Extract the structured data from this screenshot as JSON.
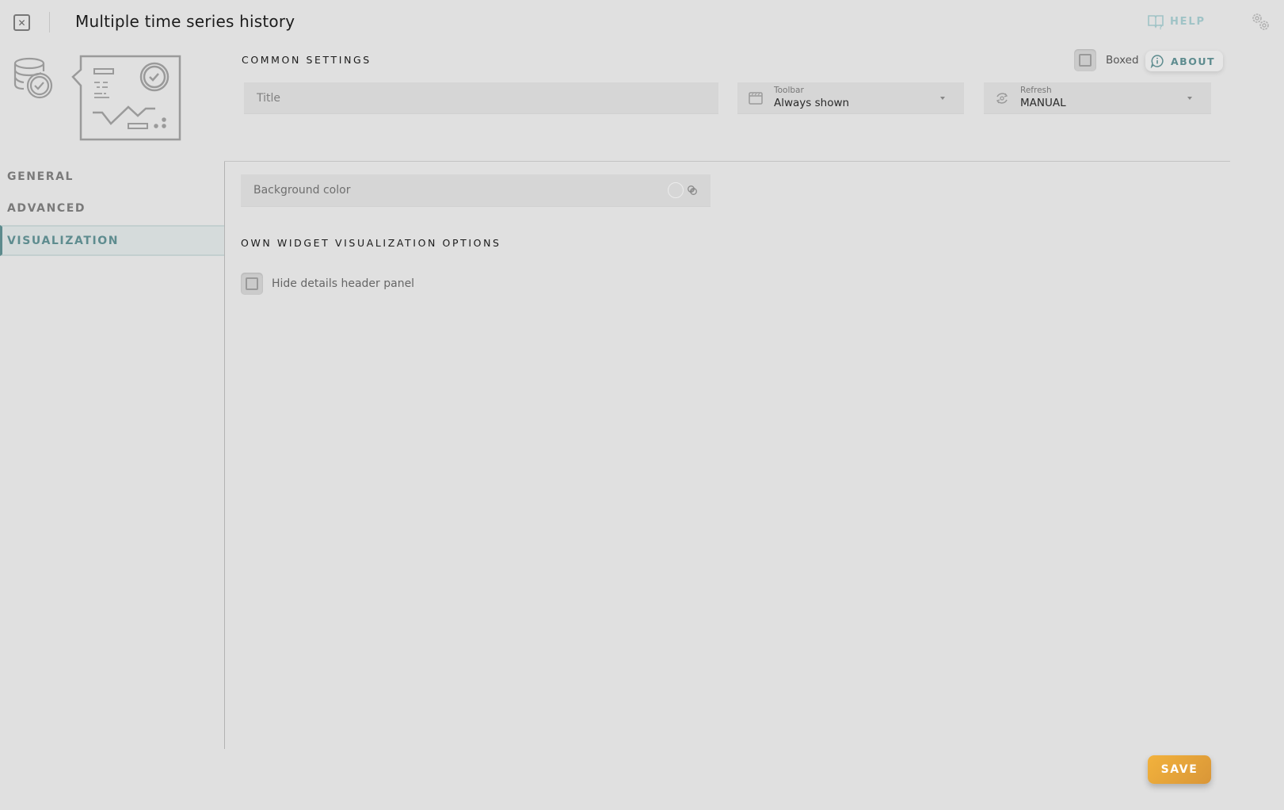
{
  "header": {
    "title": "Multiple time series history",
    "close_icon": "close-x-box-icon",
    "help_label": "HELP",
    "help_icon": "book-question-icon",
    "settings_icon": "gears-icon"
  },
  "widget_icon": "database-clock-chart-icon",
  "common_settings": {
    "section_title": "COMMON SETTINGS",
    "boxed_label": "Boxed",
    "boxed_checked": false,
    "about_label": "ABOUT",
    "about_icon": "info-bubble-icon",
    "title_field": {
      "placeholder": "Title",
      "value": ""
    },
    "toolbar": {
      "label": "Toolbar",
      "value": "Always shown",
      "icon": "window-toolbar-icon"
    },
    "refresh": {
      "label": "Refresh",
      "value": "MANUAL",
      "icon": "refresh-cycle-icon"
    }
  },
  "sidebar": {
    "items": [
      {
        "label": "GENERAL",
        "active": false
      },
      {
        "label": "ADVANCED",
        "active": false
      },
      {
        "label": "VISUALIZATION",
        "active": true
      }
    ]
  },
  "visualization": {
    "background_color": {
      "label": "Background color",
      "value": ""
    },
    "own_options_title": "OWN WIDGET VISUALIZATION OPTIONS",
    "hide_details_header": {
      "label": "Hide details header panel",
      "checked": false
    }
  },
  "footer": {
    "save_label": "SAVE",
    "save_color": "#e9a53a"
  },
  "colors": {
    "background": "#e0e0e0",
    "accent_teal": "#5e8c8f",
    "help_teal": "#9fc3c6"
  }
}
